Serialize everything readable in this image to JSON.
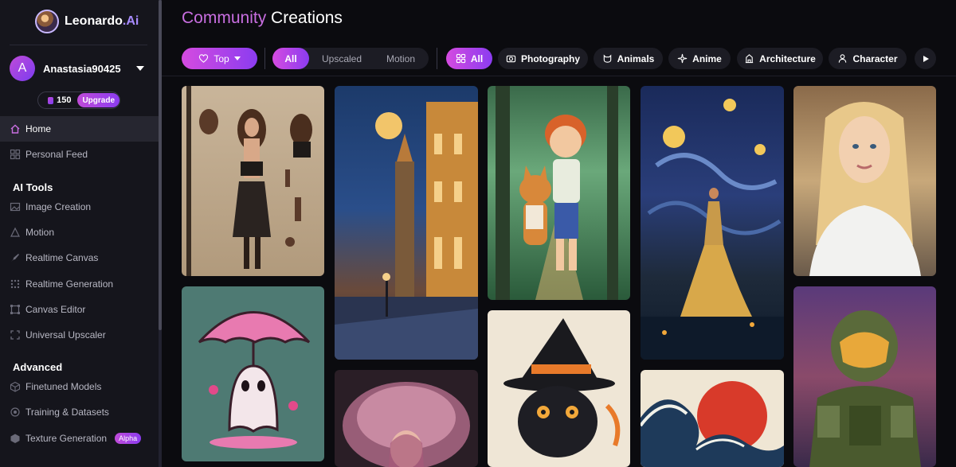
{
  "brand": {
    "name": "Leonardo",
    "suffix": ".Ai"
  },
  "user": {
    "initial": "A",
    "name": "Anastasia90425",
    "tokens": "150",
    "upgrade_label": "Upgrade"
  },
  "nav": {
    "home": "Home",
    "personal_feed": "Personal Feed",
    "ai_tools_title": "AI Tools",
    "ai_tools": [
      "Image Creation",
      "Motion",
      "Realtime Canvas",
      "Realtime Generation",
      "Canvas Editor",
      "Universal Upscaler"
    ],
    "advanced_title": "Advanced",
    "advanced": [
      "Finetuned Models",
      "Training & Datasets",
      "Texture Generation"
    ],
    "alpha_badge": "Alpha"
  },
  "page": {
    "title_accent": "Community",
    "title_rest": "Creations"
  },
  "filters": {
    "sort_label": "Top",
    "type": [
      "All",
      "Upscaled",
      "Motion"
    ],
    "categories": [
      "All",
      "Photography",
      "Animals",
      "Anime",
      "Architecture",
      "Character"
    ]
  },
  "images": [
    "Character concept sheet of a woman in black outfit",
    "Pink ghost with umbrella",
    "Starry night city street painting",
    "Jellyfish woman",
    "Boy walking with corgi in forest",
    "Black cat in witch hat",
    "Woman dancing under starry sky",
    "Wave with red sun",
    "Blonde woman portrait",
    "Armored soldier"
  ],
  "colors": {
    "accent": "#c04bd8",
    "accent2": "#8b3cf0",
    "sidebar": "#15151c",
    "background": "#0b0b0f"
  }
}
